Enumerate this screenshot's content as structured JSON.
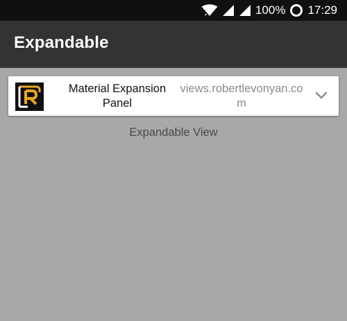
{
  "status_bar": {
    "battery_text": "100%",
    "time": "17:29",
    "icons": [
      "wifi-icon",
      "signal-icon",
      "signal-icon",
      "battery-icon"
    ]
  },
  "app_bar": {
    "title": "Expandable"
  },
  "panel": {
    "title": "Material Expansion Panel",
    "subtitle": "views.robertlevonyan.com",
    "logo_icon": "rl-logo-icon",
    "expand_icon": "chevron-down-icon",
    "colors": {
      "logo_bg": "#111111",
      "logo_accent": "#e8a623",
      "logo_fg": "#ffffff"
    }
  },
  "caption": "Expandable View"
}
